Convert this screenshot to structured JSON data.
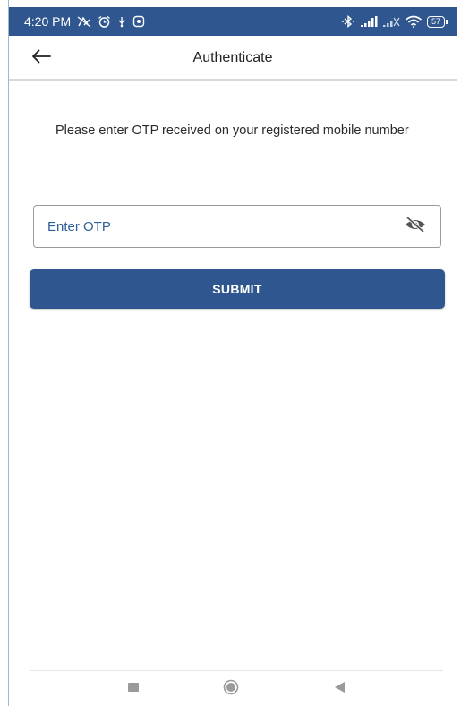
{
  "status_bar": {
    "time": "4:20 PM",
    "battery": "57",
    "background_color": "#2f568e",
    "icons_left": [
      "no-signal-status-icon",
      "alarm-icon",
      "usb-debug-icon",
      "screen-record-icon"
    ],
    "icons_right": [
      "bluetooth-icon",
      "signal-bars-icon",
      "signal-bars-2-icon",
      "wifi-icon",
      "battery-icon"
    ]
  },
  "app_bar": {
    "title": "Authenticate",
    "back_icon": "arrow-left-icon"
  },
  "instruction": {
    "text": "Please enter OTP received on your registered mobile number"
  },
  "otp_field": {
    "placeholder": "Enter OTP",
    "value": "",
    "toggle_icon": "eye-off-icon"
  },
  "submit": {
    "label": "SUBMIT",
    "color": "#2f568e"
  },
  "nav_bar": {
    "icons": [
      "recent-apps-icon",
      "home-icon",
      "back-icon"
    ]
  }
}
